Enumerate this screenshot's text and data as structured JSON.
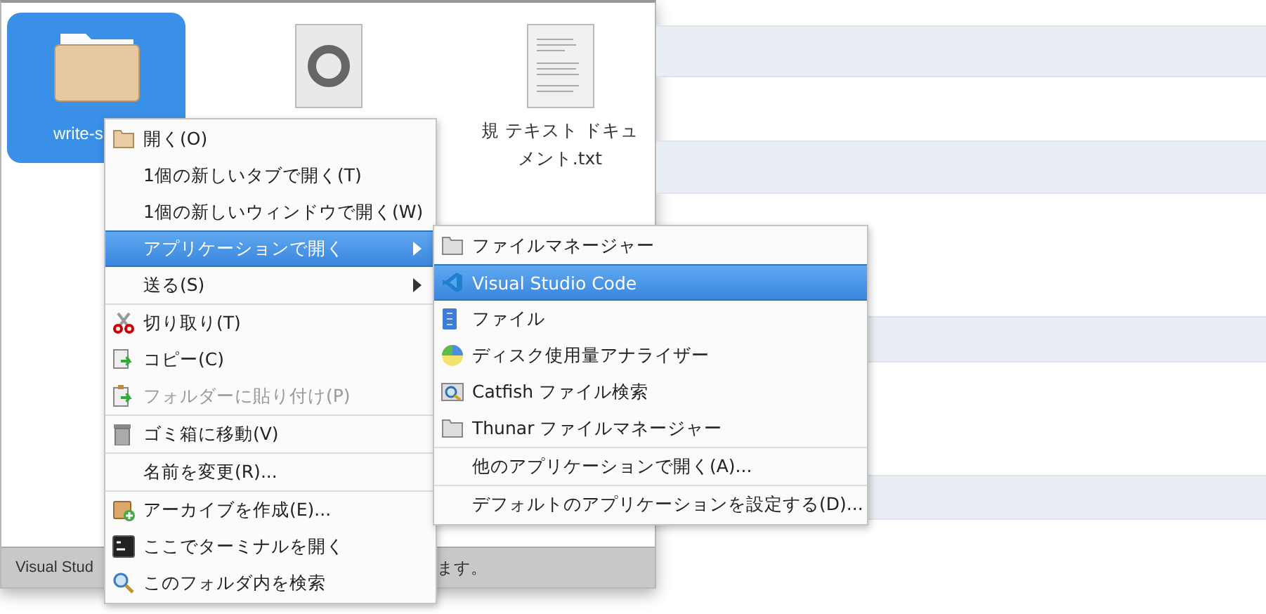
{
  "file_manager": {
    "items": [
      {
        "kind": "folder",
        "label": "write-s",
        "selected": true
      },
      {
        "kind": "json",
        "selected": false
      },
      {
        "kind": "text",
        "label": "規 テキスト ドキュメント.txt",
        "selected": false
      }
    ],
    "status_bar": {
      "texts": [
        "Visual Stud",
        "ます。"
      ]
    }
  },
  "context_menu": {
    "items": [
      {
        "kind": "folder",
        "label": "開く(O)",
        "selected": false,
        "disabled": false,
        "submenu": false,
        "separator_before": false
      },
      {
        "label": "1個の新しいタブで開く(T)",
        "selected": false,
        "disabled": false,
        "submenu": false,
        "separator_before": false
      },
      {
        "label": "1個の新しいウィンドウで開く(W)",
        "selected": false,
        "disabled": false,
        "submenu": false,
        "separator_before": false
      },
      {
        "label": "アプリケーションで開く",
        "selected": true,
        "disabled": false,
        "submenu": true,
        "separator_before": false
      },
      {
        "label": "送る(S)",
        "selected": false,
        "disabled": false,
        "submenu": true,
        "separator_before": false
      },
      {
        "kind": "scissors",
        "label": "切り取り(T)",
        "selected": false,
        "disabled": false,
        "submenu": false,
        "separator_before": true
      },
      {
        "kind": "copy",
        "label": "コピー(C)",
        "selected": false,
        "disabled": false,
        "submenu": false,
        "separator_before": false
      },
      {
        "kind": "paste",
        "label": "フォルダーに貼り付け(P)",
        "selected": false,
        "disabled": true,
        "submenu": false,
        "separator_before": false
      },
      {
        "kind": "trash",
        "label": "ゴミ箱に移動(V)",
        "selected": false,
        "disabled": false,
        "submenu": false,
        "separator_before": true
      },
      {
        "label": "名前を変更(R)...",
        "selected": false,
        "disabled": false,
        "submenu": false,
        "separator_before": true
      },
      {
        "kind": "archive",
        "label": "アーカイブを作成(E)...",
        "selected": false,
        "disabled": false,
        "submenu": false,
        "separator_before": true
      },
      {
        "kind": "terminal",
        "label": "ここでターミナルを開く",
        "selected": false,
        "disabled": false,
        "submenu": false,
        "separator_before": false
      },
      {
        "kind": "search",
        "label": "このフォルダ内を検索",
        "selected": false,
        "disabled": false,
        "submenu": false,
        "separator_before": false
      }
    ]
  },
  "submenu": {
    "items": [
      {
        "kind": "folder-grey",
        "label": "ファイルマネージャー",
        "selected": false,
        "separator_before": false
      },
      {
        "kind": "vscode",
        "label": "Visual Studio Code",
        "selected": true,
        "separator_before": false
      },
      {
        "kind": "file",
        "label": "ファイル",
        "selected": false,
        "separator_before": false
      },
      {
        "kind": "disk",
        "label": "ディスク使用量アナライザー",
        "selected": false,
        "separator_before": false
      },
      {
        "kind": "catfish",
        "label": "Catfish ファイル検索",
        "selected": false,
        "separator_before": false
      },
      {
        "kind": "folder-grey",
        "label": "Thunar ファイルマネージャー",
        "selected": false,
        "separator_before": false
      },
      {
        "label": "他のアプリケーションで開く(A)...",
        "selected": false,
        "separator_before": true
      },
      {
        "label": "デフォルトのアプリケーションを設定する(D)...",
        "selected": false,
        "separator_before": true
      }
    ]
  }
}
